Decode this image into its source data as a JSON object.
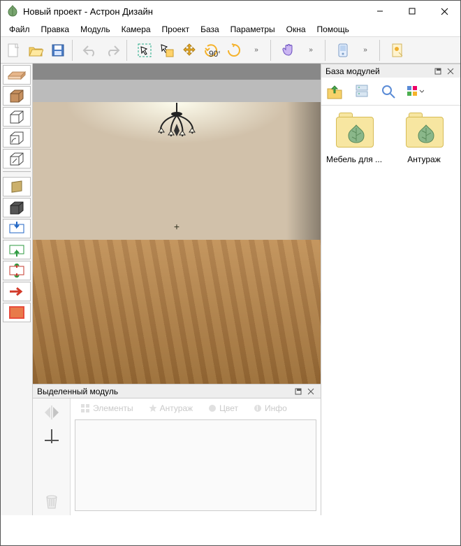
{
  "window": {
    "title": "Новый проект - Астрон Дизайн"
  },
  "menus": [
    "Файл",
    "Правка",
    "Модуль",
    "Камера",
    "Проект",
    "База",
    "Параметры",
    "Окна",
    "Помощь"
  ],
  "toolbar": {
    "new": "new",
    "open": "open",
    "save": "save",
    "undo": "undo",
    "redo": "redo",
    "select": "select",
    "selectadd": "selectadd",
    "move": "move",
    "rotate90": "rotate90",
    "rotate": "rotate",
    "hand": "hand",
    "device": "device",
    "export": "export",
    "more": "»"
  },
  "left_tools": [
    "slab",
    "box",
    "box-outline",
    "angle-box",
    "mirror-box",
    "panel",
    "dark-box",
    "insert-down",
    "insert-up",
    "insert-both",
    "arrow-right",
    "fill"
  ],
  "module_panel": {
    "title": "Выделенный модуль",
    "tabs": {
      "elements": "Элементы",
      "entourage": "Антураж",
      "color": "Цвет",
      "info": "Инфо"
    }
  },
  "right_panel": {
    "title": "База модулей",
    "folders": [
      {
        "label": "Мебель для ..."
      },
      {
        "label": "Антураж"
      }
    ]
  },
  "colors": {
    "accent": "#3a7bbf"
  }
}
